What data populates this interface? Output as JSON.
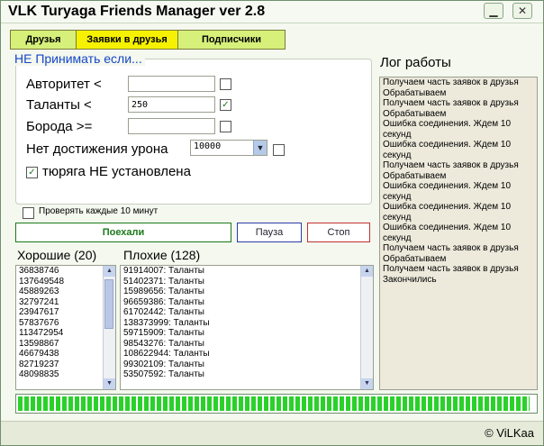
{
  "window": {
    "title": "VLK Turyaga Friends Manager ver 2.8",
    "minimize_glyph": "▁",
    "close_glyph": "✕"
  },
  "tabs": [
    {
      "label": "Друзья",
      "active": false
    },
    {
      "label": "Заявки в друзья",
      "active": true
    },
    {
      "label": "Подписчики",
      "active": false
    }
  ],
  "filters": {
    "group_title": "НЕ Принимать если...",
    "authority": {
      "label": "Авторитет <",
      "value": "",
      "checked": false
    },
    "talents": {
      "label": "Таланты <",
      "value": "250",
      "checked": true
    },
    "beard": {
      "label": "Борода >=",
      "value": "",
      "checked": false
    },
    "damage": {
      "label": "Нет достижения урона",
      "value": "10000",
      "checked": false
    },
    "tyuryaga": {
      "label": "тюряга НЕ установлена",
      "checked": true
    }
  },
  "check_every": {
    "label": "Проверять каждые 10 минут",
    "checked": false
  },
  "buttons": {
    "go": "Поехали",
    "pause": "Пауза",
    "stop": "Стоп"
  },
  "good": {
    "title": "Хорошие (20)",
    "items": [
      "36838746",
      "137649548",
      "45889263",
      "32797241",
      "23947617",
      "57837676",
      "113472954",
      "13598867",
      "46679438",
      "82719237",
      "48098835"
    ]
  },
  "bad": {
    "title": "Плохие (128)",
    "items": [
      "91914007: Таланты",
      "51402371: Таланты",
      "15989656: Таланты",
      "96659386: Таланты",
      "61702442: Таланты",
      "138373999: Таланты",
      "59715909: Таланты",
      "98543276: Таланты",
      "108622944: Таланты",
      "99302109: Таланты",
      "53507592: Таланты"
    ]
  },
  "log": {
    "title": "Лог работы",
    "lines": [
      "Получаем часть заявок в друзья",
      "Обрабатываем",
      "Получаем часть заявок в друзья",
      "Обрабатываем",
      "Ошибка соединения. Ждем 10 секунд",
      "Ошибка соединения. Ждем 10 секунд",
      "Получаем часть заявок в друзья",
      "Обрабатываем",
      "Ошибка соединения. Ждем 10 секунд",
      "Ошибка соединения. Ждем 10 секунд",
      "Ошибка соединения. Ждем 10 секунд",
      "Получаем часть заявок в друзья",
      "Обрабатываем",
      "Получаем часть заявок в друзья",
      "Закончились"
    ]
  },
  "progress": {
    "fraction": 0.99
  },
  "footer": {
    "copyright": "© ViLKaa"
  },
  "colors": {
    "accent_blue": "#1546c8",
    "tab_active": "#f5f100",
    "progress_green": "#2bd12b",
    "go_green": "#1a7a1a",
    "stop_red": "#c03030"
  }
}
